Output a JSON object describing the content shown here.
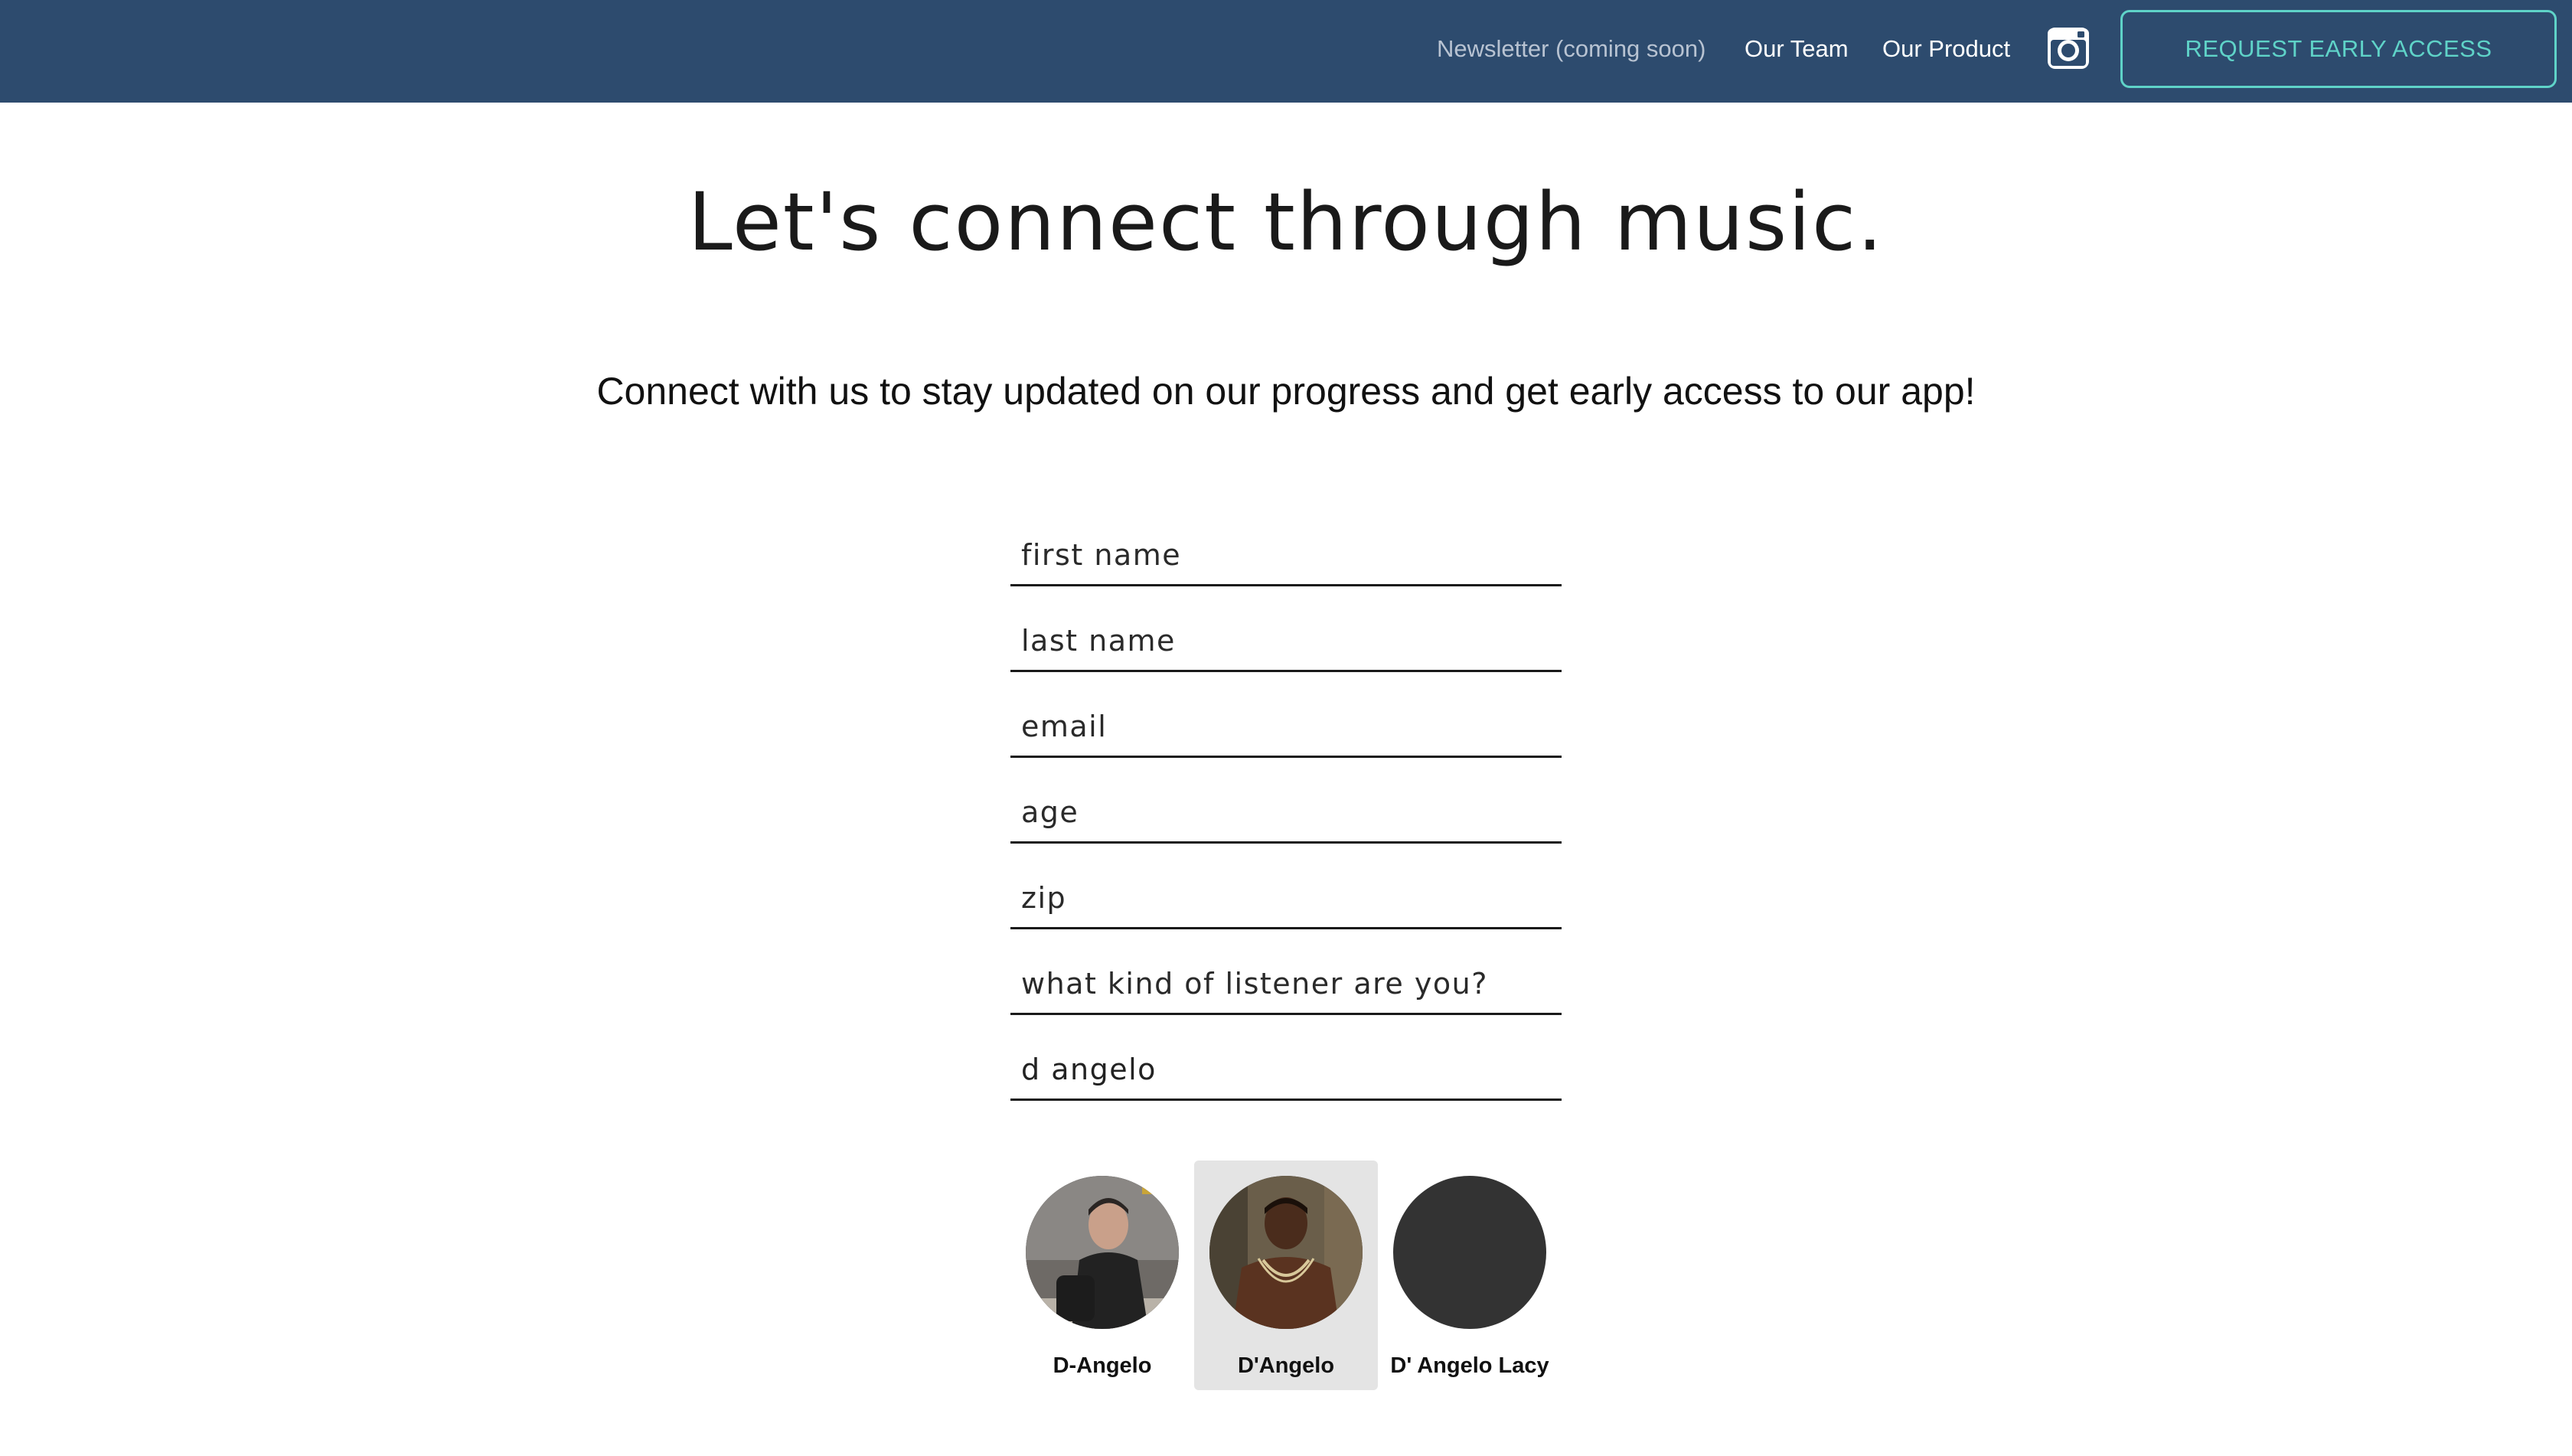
{
  "nav": {
    "newsletter": "Newsletter (coming soon)",
    "team": "Our Team",
    "product": "Our Product",
    "instagram_icon": "instagram-icon",
    "cta": "REQUEST EARLY ACCESS"
  },
  "hero": {
    "headline": "Let's connect through music.",
    "subline": "Connect with us to stay updated on our progress and get early access to our app!"
  },
  "form": {
    "first_name_placeholder": "first name",
    "last_name_placeholder": "last name",
    "email_placeholder": "email",
    "age_placeholder": "age",
    "zip_placeholder": "zip",
    "listener_placeholder": "what kind of listener are you?",
    "artist_value": "d angelo"
  },
  "results": [
    {
      "name": "D-Angelo",
      "selected": false
    },
    {
      "name": "D'Angelo",
      "selected": true
    },
    {
      "name": "D' Angelo Lacy",
      "selected": false
    }
  ],
  "colors": {
    "navbar": "#2d4b6e",
    "accent": "#5fd3c8",
    "selected_card": "#e4e4e4"
  }
}
